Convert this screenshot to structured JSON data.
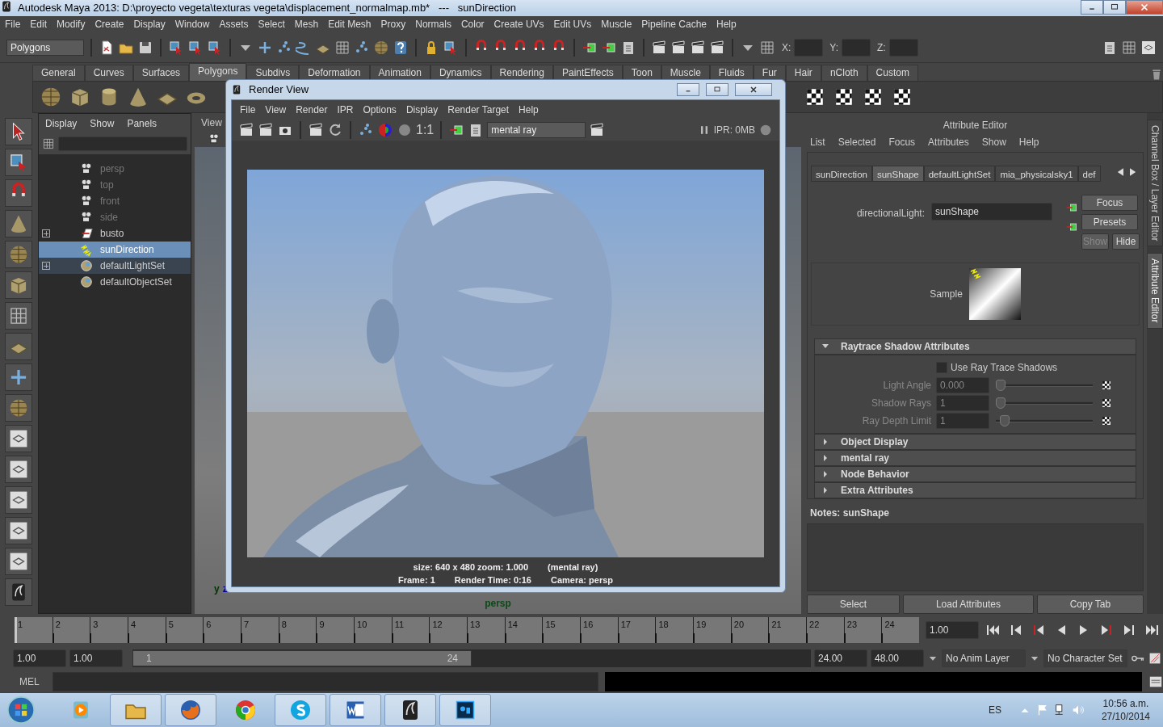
{
  "window": {
    "title": "Autodesk Maya 2013: D:\\proyecto vegeta\\texturas vegeta\\displacement_normalmap.mb*   ---   sunDirection"
  },
  "menu": [
    "File",
    "Edit",
    "Modify",
    "Create",
    "Display",
    "Window",
    "Assets",
    "Select",
    "Mesh",
    "Edit Mesh",
    "Proxy",
    "Normals",
    "Color",
    "Create UVs",
    "Edit UVs",
    "Muscle",
    "Pipeline Cache",
    "Help"
  ],
  "status_line": {
    "menu_set": "Polygons",
    "coords": [
      "X:",
      "Y:",
      "Z:"
    ]
  },
  "shelf_tabs": [
    {
      "label": "General",
      "selected": false
    },
    {
      "label": "Curves",
      "selected": false
    },
    {
      "label": "Surfaces",
      "selected": false
    },
    {
      "label": "Polygons",
      "selected": true
    },
    {
      "label": "Subdivs",
      "selected": false
    },
    {
      "label": "Deformation",
      "selected": false
    },
    {
      "label": "Animation",
      "selected": false
    },
    {
      "label": "Dynamics",
      "selected": false
    },
    {
      "label": "Rendering",
      "selected": false
    },
    {
      "label": "PaintEffects",
      "selected": false
    },
    {
      "label": "Toon",
      "selected": false
    },
    {
      "label": "Muscle",
      "selected": false
    },
    {
      "label": "Fluids",
      "selected": false
    },
    {
      "label": "Fur",
      "selected": false
    },
    {
      "label": "Hair",
      "selected": false
    },
    {
      "label": "nCloth",
      "selected": false
    },
    {
      "label": "Custom",
      "selected": false
    }
  ],
  "outliner": {
    "menu": [
      "Display",
      "Show",
      "Panels"
    ],
    "items": [
      {
        "label": "persp",
        "kind": "camera",
        "dimmed": true,
        "expandable": false,
        "selected": false,
        "highlighted": false
      },
      {
        "label": "top",
        "kind": "camera",
        "dimmed": true,
        "expandable": false,
        "selected": false,
        "highlighted": false
      },
      {
        "label": "front",
        "kind": "camera",
        "dimmed": true,
        "expandable": false,
        "selected": false,
        "highlighted": false
      },
      {
        "label": "side",
        "kind": "camera",
        "dimmed": true,
        "expandable": false,
        "selected": false,
        "highlighted": false
      },
      {
        "label": "busto",
        "kind": "mesh",
        "dimmed": false,
        "expandable": true,
        "selected": false,
        "highlighted": false
      },
      {
        "label": "sunDirection",
        "kind": "light",
        "dimmed": false,
        "expandable": false,
        "selected": true,
        "highlighted": false
      },
      {
        "label": "defaultLightSet",
        "kind": "set",
        "dimmed": false,
        "expandable": true,
        "selected": false,
        "highlighted": true
      },
      {
        "label": "defaultObjectSet",
        "kind": "set",
        "dimmed": false,
        "expandable": false,
        "selected": false,
        "highlighted": false
      }
    ]
  },
  "viewport": {
    "menu": [
      "View"
    ],
    "camera": "persp",
    "axes": [
      "y",
      "z"
    ]
  },
  "render_view": {
    "title": "Render View",
    "menu": [
      "File",
      "View",
      "Render",
      "IPR",
      "Options",
      "Display",
      "Render Target",
      "Help"
    ],
    "zoom": "1:1",
    "renderer": "mental ray",
    "ipr": "IPR: 0MB",
    "info": [
      [
        "size: 640 x 480 zoom: 1.000",
        "(mental ray)"
      ],
      [
        "Frame: 1",
        "Render Time: 0:16",
        "Camera: persp"
      ]
    ]
  },
  "attribute_editor": {
    "title": "Attribute Editor",
    "menu": [
      "List",
      "Selected",
      "Focus",
      "Attributes",
      "Show",
      "Help"
    ],
    "tabs": [
      {
        "label": "sunDirection",
        "selected": false
      },
      {
        "label": "sunShape",
        "selected": true
      },
      {
        "label": "defaultLightSet",
        "selected": false
      },
      {
        "label": "mia_physicalsky1",
        "selected": false
      },
      {
        "label": "def",
        "selected": false
      }
    ],
    "node_label": "directionalLight:",
    "node_value": "sunShape",
    "buttons": [
      {
        "label": "Focus",
        "disabled": false
      },
      {
        "label": "Presets",
        "disabled": false
      },
      {
        "label": "Show",
        "disabled": true
      },
      {
        "label": "Hide",
        "disabled": false
      }
    ],
    "sample_label": "Sample",
    "sections": [
      {
        "label": "Raytrace Shadow Attributes",
        "expanded": true,
        "children": [
          {
            "kind": "checkbox",
            "label": "Use Ray Trace Shadows",
            "checked": false
          },
          {
            "kind": "slider",
            "label": "Light Angle",
            "value": "0.000",
            "level": 0,
            "disabled": true
          },
          {
            "kind": "slider",
            "label": "Shadow Rays",
            "value": "1",
            "level": 0,
            "disabled": true
          },
          {
            "kind": "slider",
            "label": "Ray Depth Limit",
            "value": "1",
            "level": 0.05,
            "disabled": true
          }
        ]
      },
      {
        "label": "Object Display",
        "expanded": false
      },
      {
        "label": "mental ray",
        "expanded": false
      },
      {
        "label": "Node Behavior",
        "expanded": false
      },
      {
        "label": "Extra Attributes",
        "expanded": false
      }
    ],
    "notes": "Notes:  sunShape",
    "bottom_buttons": [
      "Select",
      "Load Attributes",
      "Copy Tab"
    ]
  },
  "side_tabs": [
    {
      "label": "Channel Box / Layer Editor",
      "selected": false
    },
    {
      "label": "Attribute Editor",
      "selected": true
    }
  ],
  "time_slider": {
    "ticks": [
      "1",
      "2",
      "3",
      "4",
      "5",
      "6",
      "7",
      "8",
      "9",
      "10",
      "11",
      "12",
      "13",
      "14",
      "15",
      "16",
      "17",
      "18",
      "19",
      "20",
      "21",
      "22",
      "23",
      "24"
    ],
    "current": "1.00",
    "level": 0
  },
  "range_slider": {
    "start": "1.00",
    "range_start": "1.00",
    "handle_start": "1",
    "handle_end": "24",
    "range_end": "24.00",
    "end": "48.00",
    "anim_layer": "No Anim Layer",
    "character_set": "No Character Set"
  },
  "command_line": {
    "label": "MEL"
  },
  "taskbar": {
    "apps": [
      {
        "kind": "media",
        "running": false
      },
      {
        "kind": "folder",
        "running": true
      },
      {
        "kind": "firefox",
        "running": true
      },
      {
        "kind": "chrome",
        "running": false
      },
      {
        "kind": "skype",
        "running": true
      },
      {
        "kind": "word",
        "running": true
      },
      {
        "kind": "maya",
        "running": true
      },
      {
        "kind": "photoshop",
        "running": true
      }
    ],
    "language": "ES",
    "time": "10:56 a.m.",
    "date": "27/10/2014"
  }
}
